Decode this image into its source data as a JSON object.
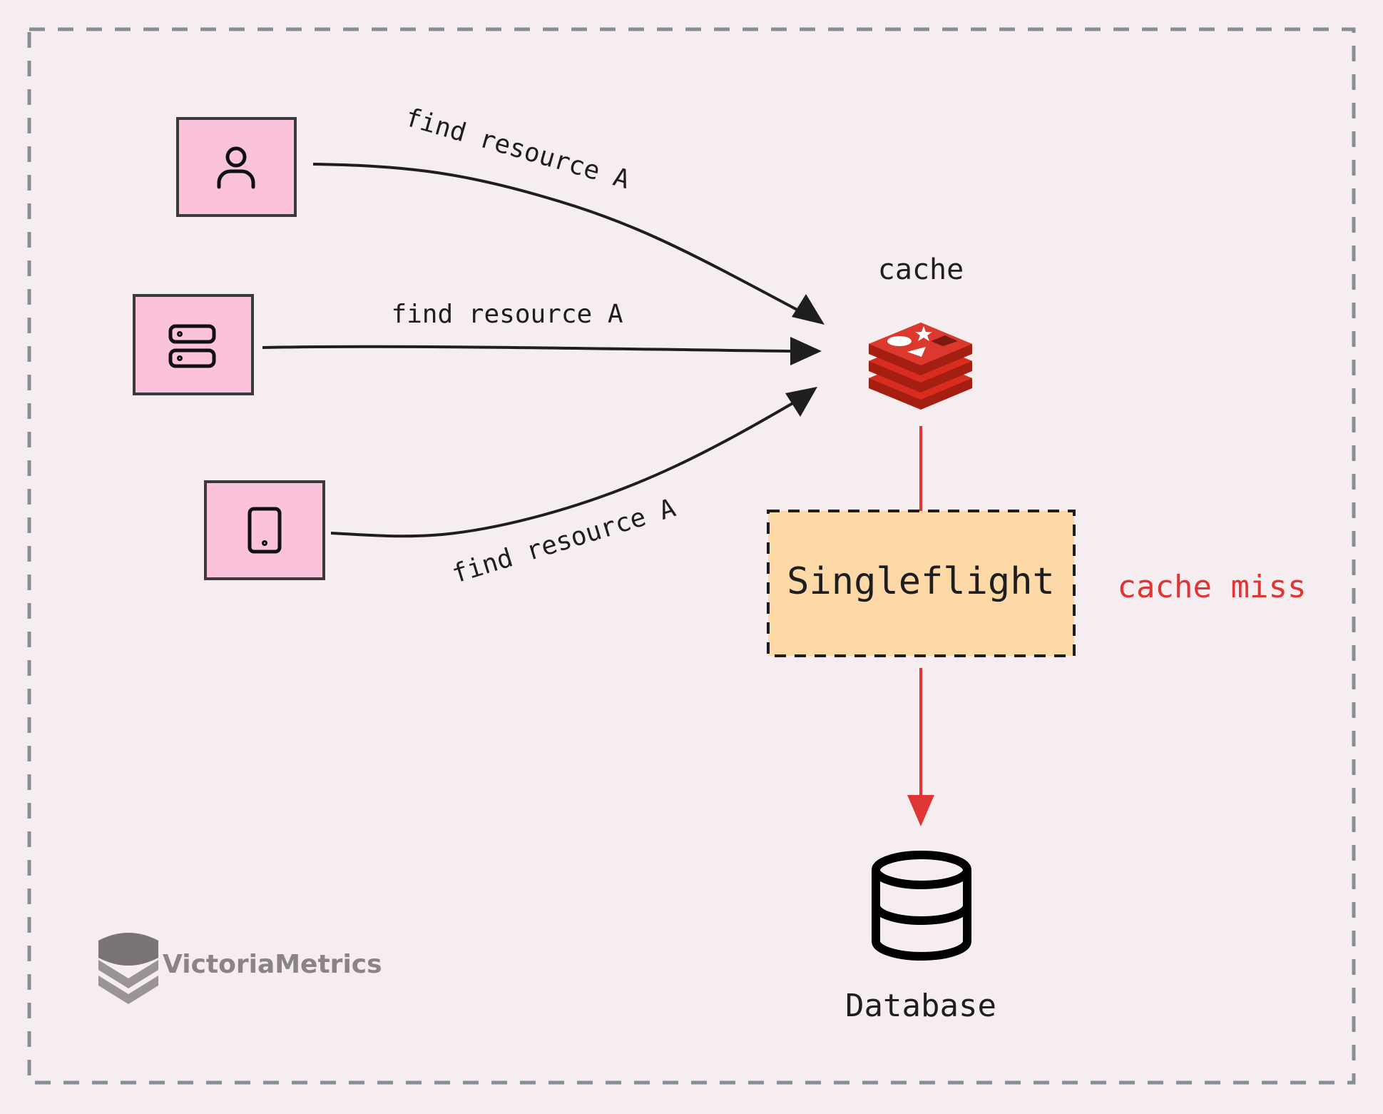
{
  "labels": {
    "request_top": "find resource A",
    "request_middle": "find resource A",
    "request_bottom": "find resource A",
    "cache": "cache",
    "singleflight": "Singleflight",
    "cache_miss": "cache miss",
    "database": "Database"
  },
  "logo": {
    "text": "VictoriaMetrics"
  },
  "clients": [
    {
      "icon": "user-icon"
    },
    {
      "icon": "server-icon"
    },
    {
      "icon": "tablet-icon"
    }
  ],
  "colors": {
    "background": "#f5edf0",
    "client_fill": "#fbc2dc",
    "singleflight_fill": "#fdd9a8",
    "miss_red": "#e03535",
    "redis_red": "#d82c20",
    "border_gray": "#868e96"
  }
}
